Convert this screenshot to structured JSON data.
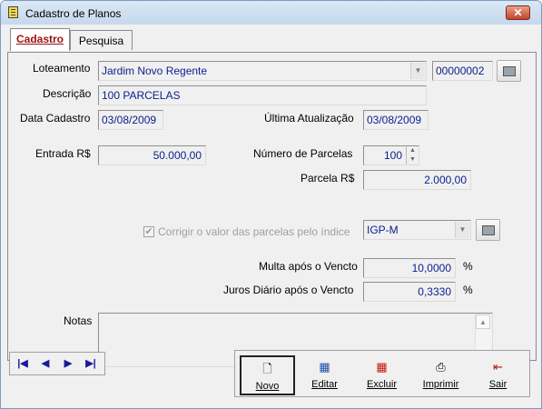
{
  "window": {
    "title": "Cadastro de Planos",
    "close_glyph": "✕"
  },
  "tabs": [
    {
      "label": "Cadastro"
    },
    {
      "label": "Pesquisa"
    }
  ],
  "form": {
    "loteamento": {
      "label": "Loteamento",
      "value": "Jardim Novo Regente",
      "code": "00000002"
    },
    "descricao": {
      "label": "Descrição",
      "value": "100 PARCELAS"
    },
    "data_cadastro": {
      "label": "Data Cadastro",
      "value": "03/08/2009"
    },
    "ultima_atualizacao": {
      "label": "Última Atualização",
      "value": "03/08/2009"
    },
    "entrada": {
      "label": "Entrada R$",
      "value": "50.000,00"
    },
    "numero_parcelas": {
      "label": "Número de Parcelas",
      "value": "100"
    },
    "parcela": {
      "label": "Parcela R$",
      "value": "2.000,00"
    },
    "corrigir": {
      "label": "Corrigir o valor das parcelas pelo índice",
      "checked": true,
      "index": "IGP-M"
    },
    "multa": {
      "label": "Multa após o Vencto",
      "value": "10,0000",
      "unit": "%"
    },
    "juros": {
      "label": "Juros Diário após o Vencto",
      "value": "0,3330",
      "unit": "%"
    },
    "notas": {
      "label": "Notas",
      "value": ""
    }
  },
  "navigator": [
    "|◀",
    "◀",
    "▶",
    "▶|"
  ],
  "actions": {
    "novo": "Novo",
    "editar": "Editar",
    "excluir": "Excluir",
    "imprimir": "Imprimir",
    "sair": "Sair"
  },
  "icons": {
    "window": "notebook-icon",
    "search": "binoculars-icon",
    "novo": "new-document-icon",
    "editar": "edit-grid-icon",
    "excluir": "delete-grid-icon",
    "imprimir": "printer-icon",
    "sair": "exit-door-icon"
  }
}
